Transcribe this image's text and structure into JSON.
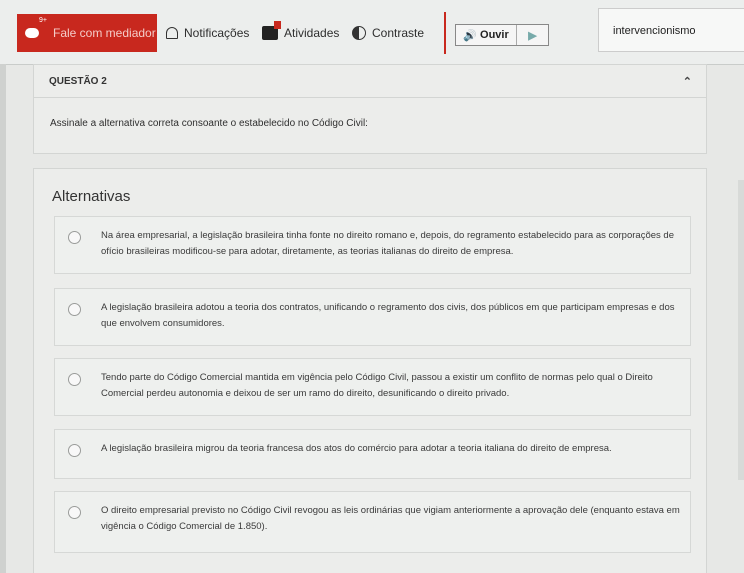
{
  "toolbar": {
    "mediator_label": "Fale com mediador",
    "mediator_badge": "9+",
    "notifications_label": "Notificações",
    "activities_label": "Atividades",
    "contrast_label": "Contraste",
    "listen_label": "Ouvir",
    "search_value": "intervencionismo"
  },
  "question": {
    "title": "QUESTÃO 2",
    "text": "Assinale a alternativa correta consoante o estabelecido no Código Civil:"
  },
  "alternatives": {
    "heading": "Alternativas",
    "options": [
      "Na área empresarial, a legislação brasileira tinha fonte no direito romano e, depois, do regramento estabelecido para as corporações de ofício brasileiras modificou-se para adotar, diretamente, as teorias italianas do direito de empresa.",
      "A legislação brasileira adotou a teoria dos contratos, unificando o regramento dos civis, dos públicos em que participam empresas e dos que envolvem consumidores.",
      "Tendo parte do Código Comercial mantida em vigência pelo Código Civil, passou a existir um conflito de normas pelo qual o Direito Comercial perdeu autonomia e deixou de ser um ramo do direito, desunificando o direito privado.",
      "A legislação brasileira migrou da teoria francesa dos atos do comércio para adotar a teoria italiana do direito de empresa.",
      "O direito empresarial previsto no Código Civil revogou as leis ordinárias que vigiam anteriormente a aprovação dele (enquanto estava em vigência o Código Comercial de 1.850)."
    ]
  },
  "colors": {
    "accent": "#c8281e",
    "background": "#e7e8e6"
  }
}
